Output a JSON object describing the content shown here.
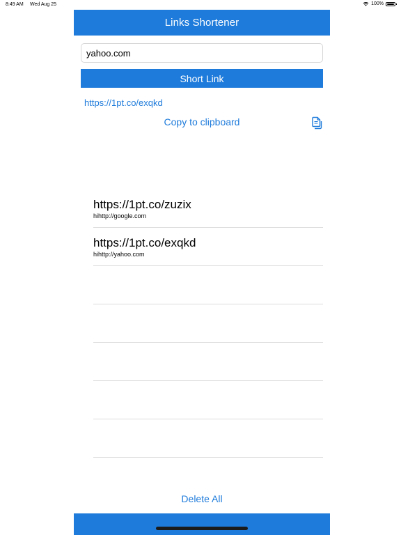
{
  "status_bar": {
    "time": "8:49 AM",
    "date": "Wed Aug 25",
    "battery": "100%"
  },
  "nav": {
    "title": "Links Shortener"
  },
  "form": {
    "input_value": "yahoo.com",
    "button_label": "Short Link"
  },
  "result": {
    "short_url": "https://1pt.co/exqkd",
    "copy_label": "Copy to clipboard"
  },
  "history": [
    {
      "short": "https://1pt.co/zuzix",
      "original": "hihttp://google.com"
    },
    {
      "short": "https://1pt.co/exqkd",
      "original": "hihttp://yahoo.com"
    },
    {
      "short": "",
      "original": ""
    },
    {
      "short": "",
      "original": ""
    },
    {
      "short": "",
      "original": ""
    },
    {
      "short": "",
      "original": ""
    },
    {
      "short": "",
      "original": ""
    }
  ],
  "footer": {
    "delete_all_label": "Delete All"
  },
  "colors": {
    "accent": "#1e7bdb"
  },
  "icons": {
    "copy": "copy-icon",
    "wifi": "wifi-icon",
    "battery": "battery-icon"
  }
}
